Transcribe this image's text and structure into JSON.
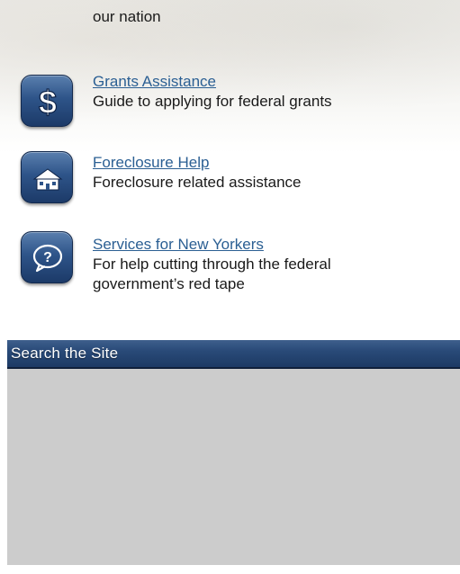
{
  "services": {
    "top_fragment": "our nation",
    "items": [
      {
        "icon": "dollar-icon",
        "link": "Grants Assistance",
        "description": "Guide to applying for federal grants"
      },
      {
        "icon": "house-icon",
        "link": "Foreclosure Help",
        "description": "Foreclosure related assistance"
      },
      {
        "icon": "question-bubble-icon",
        "link": "Services for New Yorkers",
        "description_line1": "For help cutting through the federal",
        "description_line2": "government’s red tape"
      }
    ]
  },
  "search": {
    "title": "Search the Site"
  },
  "colors": {
    "link": "#2b5f93",
    "icon_badge": "#2e5489",
    "search_header": "#294a78",
    "search_body": "#cccccc"
  }
}
